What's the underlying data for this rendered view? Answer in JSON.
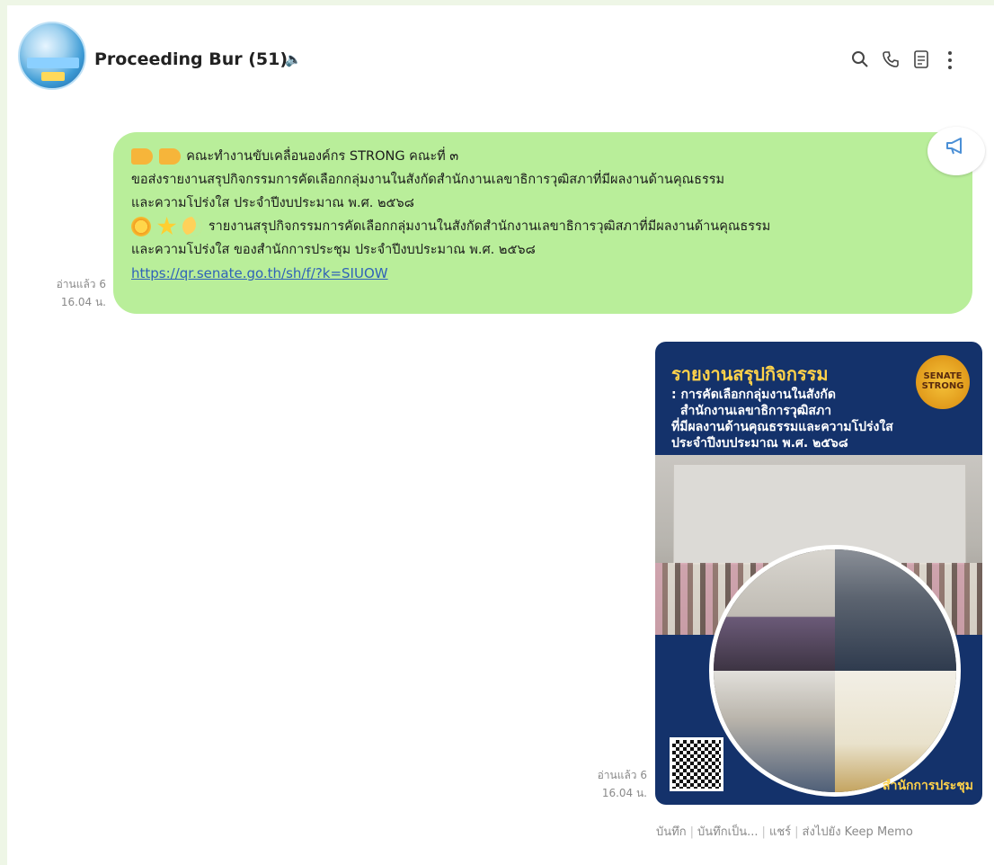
{
  "header": {
    "title": "Proceeding Bur (51)",
    "mute_icon": "speaker-muted-icon",
    "icons": [
      "search-icon",
      "phone-icon",
      "notes-icon",
      "more-icon"
    ]
  },
  "messages": [
    {
      "type": "text",
      "lines": [
        "คณะทำงานขับเคลื่อนองค์กร STRONG คณะที่ ๓",
        "ขอส่งรายงานสรุปกิจกรรมการคัดเลือกกลุ่มงานในสังกัดสำนักงานเลขาธิการวุฒิสภาที่มีผลงานด้านคุณธรรม",
        "และความโปร่งใส ประจำปีงบประมาณ พ.ศ. ๒๕๖๘",
        "รายงานสรุปกิจกรรมการคัดเลือกกลุ่มงานในสังกัดสำนักงานเลขาธิการวุฒิสภาที่มีผลงานด้านคุณธรรม",
        "และความโปร่งใส ของสำนักการประชุม ประจำปีงบประมาณ พ.ศ. ๒๕๖๘"
      ],
      "link": "https://qr.senate.go.th/sh/f/?k=SIUOW",
      "read": "อ่านแล้ว 6",
      "time": "16.04 น.",
      "announce_icon": "megaphone-icon"
    },
    {
      "type": "image",
      "poster": {
        "title": "รายงานสรุปกิจกรรม",
        "subtitle_lines": [
          ": การคัดเลือกกลุ่มงานในสังกัด",
          "สำนักงานเลขาธิการวุฒิสภา",
          "ที่มีผลงานด้านคุณธรรมและความโปร่งใส",
          "ประจำปีงบประมาณ พ.ศ. ๒๕๖๘"
        ],
        "seal_text": "SENATE STRONG",
        "footer": "สำนักการประชุม"
      },
      "read": "อ่านแล้ว 6",
      "time": "16.04 น."
    }
  ],
  "image_actions": [
    "บันทึก",
    "บันทึกเป็น...",
    "แชร์",
    "ส่งไปยัง Keep Memo"
  ]
}
